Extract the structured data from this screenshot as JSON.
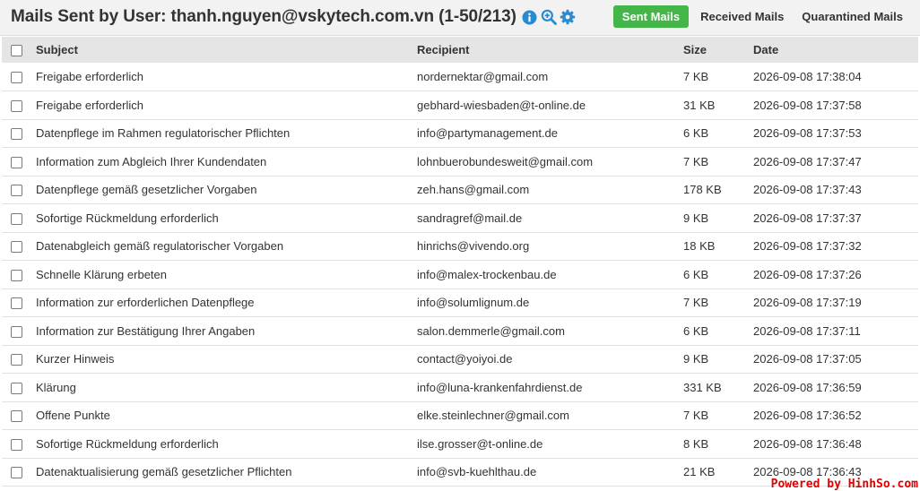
{
  "header": {
    "title": "Mails Sent by User: thanh.nguyen@vskytech.com.vn (1-50/213)",
    "tabs": {
      "sent": "Sent Mails",
      "received": "Received Mails",
      "quarantined": "Quarantined Mails"
    },
    "icons": [
      "info-icon",
      "zoom-icon",
      "gear-icon"
    ]
  },
  "colors": {
    "accent": "#2a8bd0",
    "active_tab": "#44b649",
    "watermark": "#e00000"
  },
  "table": {
    "columns": {
      "subject": "Subject",
      "recipient": "Recipient",
      "size": "Size",
      "date": "Date"
    },
    "rows": [
      {
        "subject": "Freigabe erforderlich",
        "recipient": "nordernektar@gmail.com",
        "size": "7 KB",
        "date": "2026-09-08 17:38:04"
      },
      {
        "subject": "Freigabe erforderlich",
        "recipient": "gebhard-wiesbaden@t-online.de",
        "size": "31 KB",
        "date": "2026-09-08 17:37:58"
      },
      {
        "subject": "Datenpflege im Rahmen regulatorischer Pflichten",
        "recipient": "info@partymanagement.de",
        "size": "6 KB",
        "date": "2026-09-08 17:37:53"
      },
      {
        "subject": "Information zum Abgleich Ihrer Kundendaten",
        "recipient": "lohnbuerobundesweit@gmail.com",
        "size": "7 KB",
        "date": "2026-09-08 17:37:47"
      },
      {
        "subject": "Datenpflege gemäß gesetzlicher Vorgaben",
        "recipient": "zeh.hans@gmail.com",
        "size": "178 KB",
        "date": "2026-09-08 17:37:43"
      },
      {
        "subject": "Sofortige Rückmeldung erforderlich",
        "recipient": "sandragref@mail.de",
        "size": "9 KB",
        "date": "2026-09-08 17:37:37"
      },
      {
        "subject": "Datenabgleich gemäß regulatorischer Vorgaben",
        "recipient": "hinrichs@vivendo.org",
        "size": "18 KB",
        "date": "2026-09-08 17:37:32"
      },
      {
        "subject": "Schnelle Klärung erbeten",
        "recipient": "info@malex-trockenbau.de",
        "size": "6 KB",
        "date": "2026-09-08 17:37:26"
      },
      {
        "subject": "Information zur erforderlichen Datenpflege",
        "recipient": "info@solumlignum.de",
        "size": "7 KB",
        "date": "2026-09-08 17:37:19"
      },
      {
        "subject": "Information zur Bestätigung Ihrer Angaben",
        "recipient": "salon.demmerle@gmail.com",
        "size": "6 KB",
        "date": "2026-09-08 17:37:11"
      },
      {
        "subject": "Kurzer Hinweis",
        "recipient": "contact@yoiyoi.de",
        "size": "9 KB",
        "date": "2026-09-08 17:37:05"
      },
      {
        "subject": "Klärung",
        "recipient": "info@luna-krankenfahrdienst.de",
        "size": "331 KB",
        "date": "2026-09-08 17:36:59"
      },
      {
        "subject": "Offene Punkte",
        "recipient": "elke.steinlechner@gmail.com",
        "size": "7 KB",
        "date": "2026-09-08 17:36:52"
      },
      {
        "subject": "Sofortige Rückmeldung erforderlich",
        "recipient": "ilse.grosser@t-online.de",
        "size": "8 KB",
        "date": "2026-09-08 17:36:48"
      },
      {
        "subject": "Datenaktualisierung gemäß gesetzlicher Pflichten",
        "recipient": "info@svb-kuehlthau.de",
        "size": "21 KB",
        "date": "2026-09-08 17:36:43"
      }
    ]
  },
  "watermark": "Powered by HinhSo.com"
}
